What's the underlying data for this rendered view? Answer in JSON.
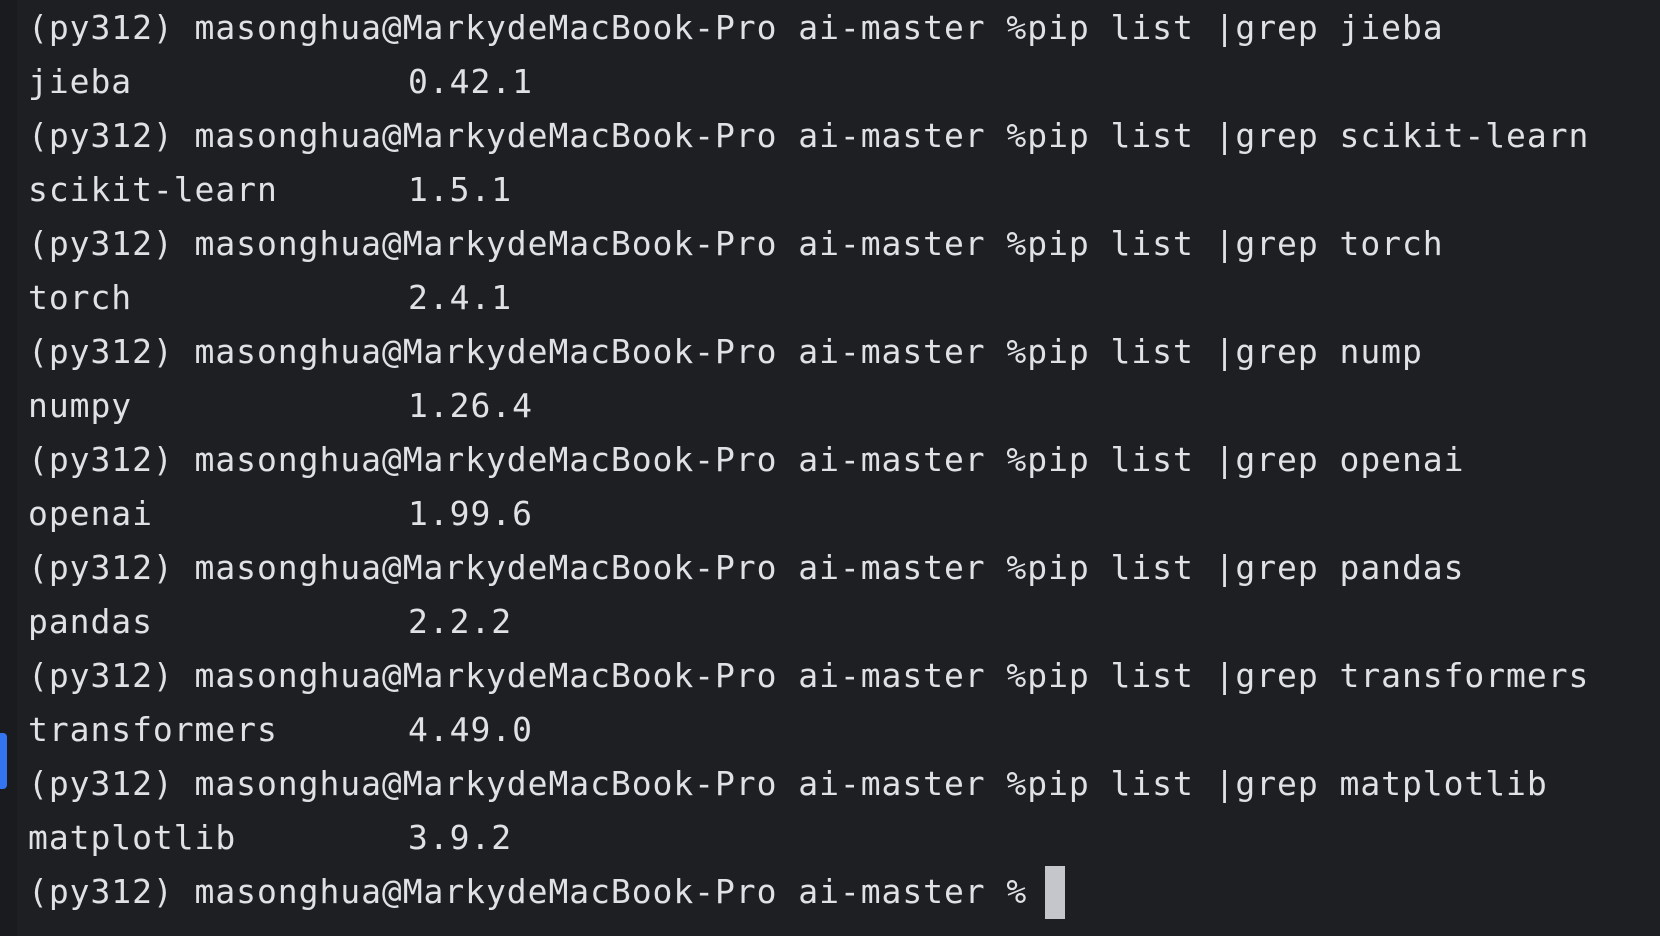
{
  "terminal": {
    "prompt": "(py312) masonghua@MarkydeMacBook-Pro ai-master %",
    "entries": [
      {
        "command": "pip list |grep jieba",
        "package": "jieba",
        "version": "0.42.1"
      },
      {
        "command": "pip list |grep scikit-learn",
        "package": "scikit-learn",
        "version": "1.5.1"
      },
      {
        "command": "pip list |grep torch",
        "package": "torch",
        "version": "2.4.1"
      },
      {
        "command": "pip list |grep nump",
        "package": "numpy",
        "version": "1.26.4"
      },
      {
        "command": "pip list |grep openai",
        "package": "openai",
        "version": "1.99.6"
      },
      {
        "command": "pip list |grep pandas",
        "package": "pandas",
        "version": "2.2.2"
      },
      {
        "command": "pip list |grep transformers",
        "package": "transformers",
        "version": "4.49.0"
      },
      {
        "command": "pip list |grep matplotlib",
        "package": "matplotlib",
        "version": "3.9.2"
      }
    ],
    "current_input": "",
    "colors": {
      "background": "#1e1f22",
      "text": "#dfe1e5",
      "cursor": "#c4c6cc",
      "gutter_marker": "#3574f0"
    }
  }
}
